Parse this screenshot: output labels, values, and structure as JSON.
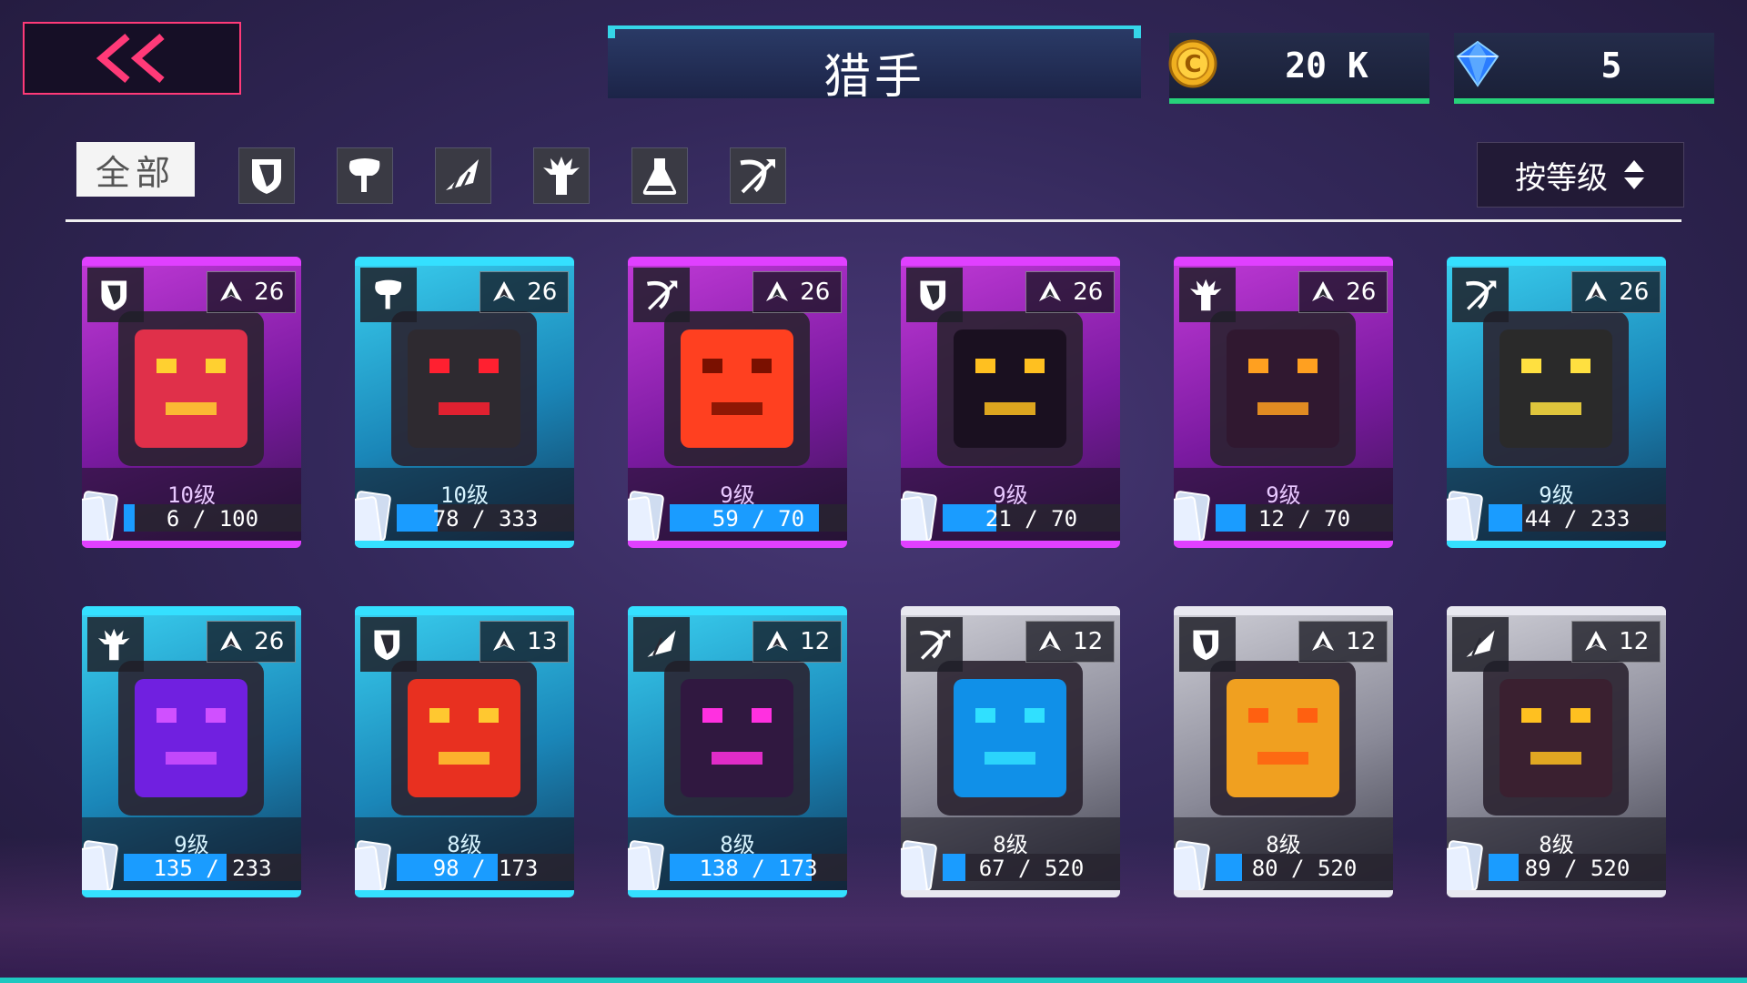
{
  "header": {
    "title": "猎手",
    "gold_value": "20 K",
    "gem_value": "5"
  },
  "filters": {
    "all_label": "全部",
    "categories": [
      "shield-icon",
      "axe-icon",
      "launcher-icon",
      "spike-icon",
      "flask-icon",
      "bow-icon"
    ],
    "sort_label": "按等级"
  },
  "colors": {
    "purple_card": "#a020c8",
    "cyan_card": "#1fb4d8",
    "silver_card": "#8a8a96",
    "accent_green": "#27d27a",
    "back_red": "#ff3a78"
  },
  "cards": [
    {
      "class_icon": "shield-icon",
      "rating": "26",
      "level": "10级",
      "progress": "6 / 100",
      "fill": 0.06,
      "theme": "purple",
      "face": "red"
    },
    {
      "class_icon": "axe-icon",
      "rating": "26",
      "level": "10级",
      "progress": "78 / 333",
      "fill": 0.23,
      "theme": "cyan",
      "face": "dark"
    },
    {
      "class_icon": "bow-icon",
      "rating": "26",
      "level": "9级",
      "progress": "59 / 70",
      "fill": 0.84,
      "theme": "purple",
      "face": "orange"
    },
    {
      "class_icon": "shield-icon",
      "rating": "26",
      "level": "9级",
      "progress": "21 / 70",
      "fill": 0.3,
      "theme": "purple",
      "face": "k"
    },
    {
      "class_icon": "spike-icon",
      "rating": "26",
      "level": "9级",
      "progress": "12 / 70",
      "fill": 0.17,
      "theme": "purple",
      "face": "flame"
    },
    {
      "class_icon": "bow-icon",
      "rating": "26",
      "level": "9级",
      "progress": "44 / 233",
      "fill": 0.19,
      "theme": "cyan",
      "face": "grin"
    },
    {
      "class_icon": "spike-icon",
      "rating": "26",
      "level": "9级",
      "progress": "135 / 233",
      "fill": 0.58,
      "theme": "cyan",
      "face": "sleep"
    },
    {
      "class_icon": "shield-icon",
      "rating": "13",
      "level": "8级",
      "progress": "98 / 173",
      "fill": 0.57,
      "theme": "cyan",
      "face": "fire"
    },
    {
      "class_icon": "launcher-icon",
      "rating": "12",
      "level": "8级",
      "progress": "138 / 173",
      "fill": 0.8,
      "theme": "cyan",
      "face": "purple"
    },
    {
      "class_icon": "bow-icon",
      "rating": "12",
      "level": "8级",
      "progress": "67 / 520",
      "fill": 0.13,
      "theme": "silver",
      "face": "blue"
    },
    {
      "class_icon": "shield-icon",
      "rating": "12",
      "level": "8级",
      "progress": "80 / 520",
      "fill": 0.15,
      "theme": "silver",
      "face": "gold"
    },
    {
      "class_icon": "launcher-icon",
      "rating": "12",
      "level": "8级",
      "progress": "89 / 520",
      "fill": 0.17,
      "theme": "silver",
      "face": "box"
    }
  ]
}
